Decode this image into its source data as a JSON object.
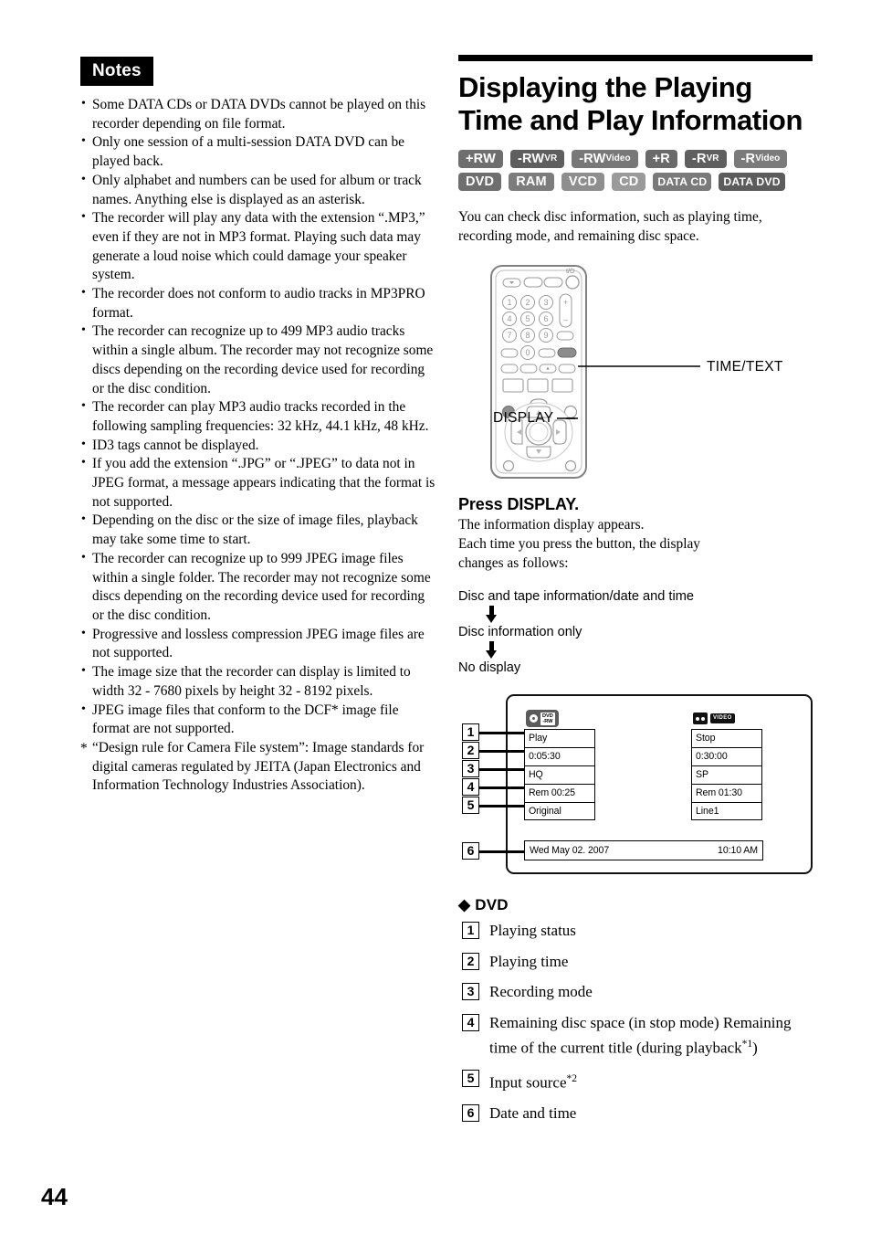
{
  "page": {
    "number": "44"
  },
  "notes": {
    "header": "Notes",
    "bullet_glyph": "•",
    "items": [
      "Some DATA CDs or DATA DVDs cannot be played on this recorder depending on file format.",
      "Only one session of a multi-session DATA DVD can be played back.",
      "Only alphabet and numbers can be used for album or track names. Anything else is displayed as an asterisk.",
      "The recorder will play any data with the extension “.MP3,” even if they are not in MP3 format. Playing such data may generate a loud noise which could damage your speaker system.",
      "The recorder does not conform to audio tracks in MP3PRO format.",
      "The recorder can recognize up to 499 MP3 audio tracks within a single album. The recorder may not recognize some discs depending on the recording device used for recording or the disc condition.",
      "The recorder can play MP3 audio tracks recorded in the following sampling frequencies: 32 kHz, 44.1 kHz, 48 kHz.",
      "ID3 tags cannot be displayed.",
      "If you add the extension “.JPG” or “.JPEG” to data not in JPEG format, a message appears indicating that the format is not supported.",
      "Depending on the disc or the size of image files, playback may take some time to start.",
      "The recorder can recognize up to 999 JPEG image files within a single folder. The recorder may not recognize some discs depending on the recording device used for recording or the disc condition.",
      "Progressive and lossless compression JPEG image files are not supported.",
      "The image size that the recorder can display is limited to width 32 - 7680 pixels by height 32 - 8192 pixels.",
      "JPEG image files that conform to the DCF* image file format are not supported."
    ],
    "footnote_glyph": "*",
    "footnote": "“Design rule for Camera File system”: Image standards for digital cameras regulated by JEITA (Japan Electronics and Information Technology Industries Association)."
  },
  "section": {
    "title": "Displaying the Playing Time and Play Information",
    "intro": "You can check disc information, such as playing time, recording mode, and remaining disc space."
  },
  "badges": {
    "row1": [
      {
        "main": "+RW",
        "sub": "",
        "bg": "#6e6e6e"
      },
      {
        "main": "-RW",
        "sub": "VR",
        "bg": "#5e5e5e"
      },
      {
        "main": "-RW",
        "sub": "Video",
        "bg": "#787878"
      },
      {
        "main": "+R",
        "sub": "",
        "bg": "#6a6a6a"
      },
      {
        "main": "-R",
        "sub": "VR",
        "bg": "#5f5f5f"
      },
      {
        "main": "-R",
        "sub": "Video",
        "bg": "#7b7b7b"
      }
    ],
    "row2": [
      {
        "main": "DVD",
        "sub": "",
        "bg": "#6e6e6e"
      },
      {
        "main": "RAM",
        "sub": "",
        "bg": "#7c7c7c"
      },
      {
        "main": "VCD",
        "sub": "",
        "bg": "#8e8e8e"
      },
      {
        "main": "CD",
        "sub": "",
        "bg": "#9a9a9a"
      },
      {
        "main": "DATA CD",
        "sub": "",
        "bg": "#7a7a7a"
      },
      {
        "main": "DATA DVD",
        "sub": "",
        "bg": "#5c5c5c"
      }
    ]
  },
  "remote": {
    "label_time_text": "TIME/TEXT",
    "label_display": "DISPLAY",
    "power_symbol": "I/⏻",
    "number_keys": [
      "1",
      "2",
      "3",
      "4",
      "5",
      "6",
      "7",
      "8",
      "9",
      "0"
    ],
    "volume_plus": "+",
    "volume_minus": "–"
  },
  "step": {
    "heading": "Press DISPLAY.",
    "line1": "The information display appears.",
    "line2": "Each time you press the button, the display",
    "line3": "changes as follows:",
    "flow": [
      "Disc and tape information/date and time",
      "Disc information only",
      "No display"
    ]
  },
  "osd": {
    "left_column": {
      "icon": {
        "kind": "disc-icon",
        "tag_top": "DVD",
        "tag_bottom": "-RW"
      },
      "cells": [
        "Play",
        "0:05:30",
        "HQ",
        "Rem 00:25",
        "Original"
      ]
    },
    "right_column": {
      "icons": [
        {
          "kind": "tape-icon"
        },
        {
          "kind": "video-icon",
          "text": "VIDEO"
        }
      ],
      "cells": [
        "Stop",
        "0:30:00",
        "SP",
        "Rem 01:30",
        "Line1"
      ]
    },
    "datebar": {
      "date": "Wed May 02. 2007",
      "time": "10:10 AM"
    },
    "callout_numbers": [
      "1",
      "2",
      "3",
      "4",
      "5",
      "6"
    ]
  },
  "legend": {
    "heading_marker": "◆",
    "heading": "DVD",
    "items": [
      {
        "num": "1",
        "text": "Playing status",
        "sup": ""
      },
      {
        "num": "2",
        "text": "Playing time",
        "sup": ""
      },
      {
        "num": "3",
        "text": "Recording mode",
        "sup": ""
      },
      {
        "num": "4",
        "text": "Remaining disc space (in stop mode) Remaining time of the current title (during playback",
        "sup": "*1",
        "tail": ")"
      },
      {
        "num": "5",
        "text": "Input source",
        "sup": "*2",
        "tail": ""
      },
      {
        "num": "6",
        "text": "Date and time",
        "sup": ""
      }
    ]
  }
}
